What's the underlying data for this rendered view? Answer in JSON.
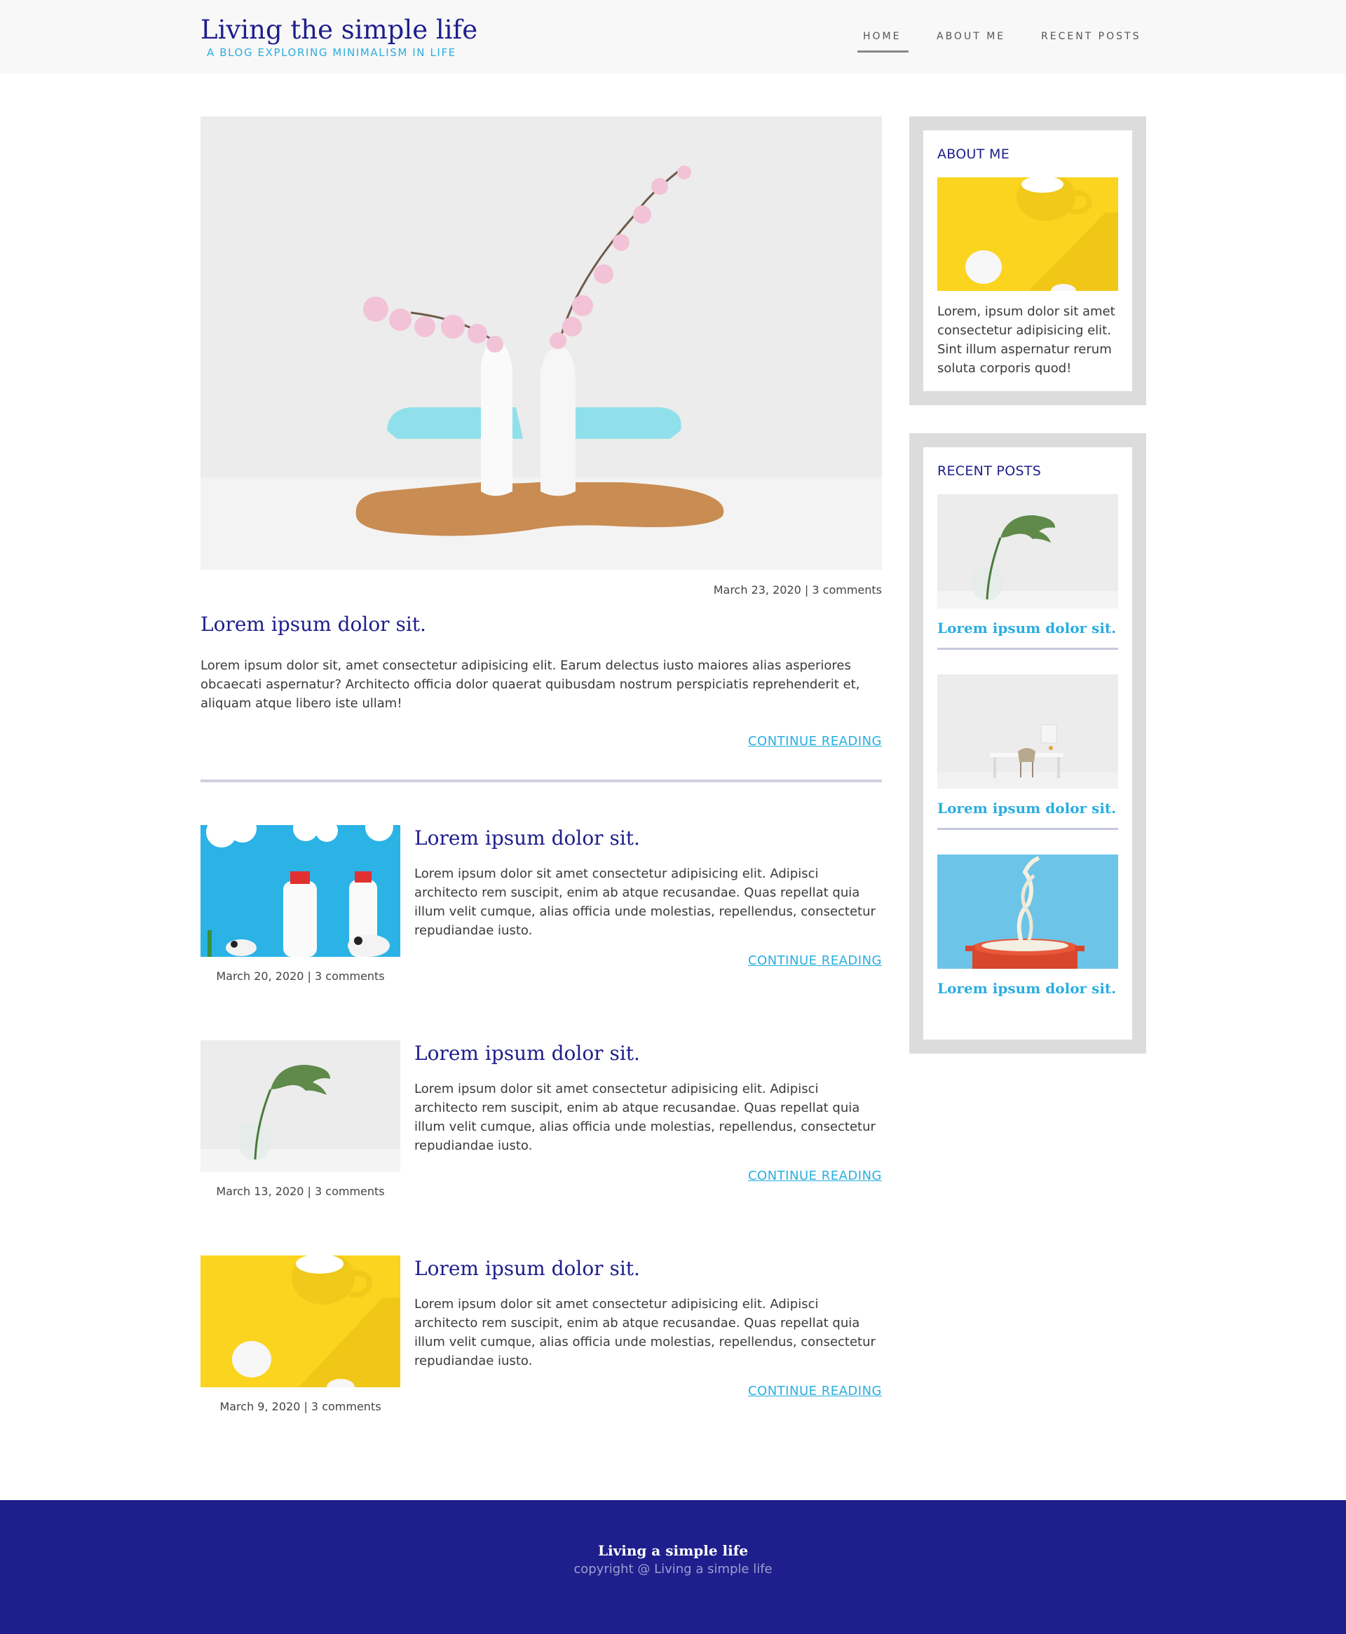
{
  "header": {
    "site_title": "Living the simple life",
    "tagline": "A BLOG EXPLORING MINIMALISM IN LIFE",
    "nav": [
      {
        "label": "HOME",
        "active": true
      },
      {
        "label": "ABOUT ME",
        "active": false
      },
      {
        "label": "RECENT POSTS",
        "active": false
      }
    ]
  },
  "featured": {
    "meta": "March 23, 2020 | 3 comments",
    "title": "Lorem ipsum dolor sit.",
    "excerpt": "Lorem ipsum dolor sit, amet consectetur adipisicing elit. Earum delectus iusto maiores alias asperiores obcaecati aspernatur? Architecto officia dolor quaerat quibusdam nostrum perspiciatis reprehenderit et, aliquam atque libero iste ullam!",
    "continue": "CONTINUE READING"
  },
  "posts": [
    {
      "title": "Lorem ipsum dolor sit.",
      "excerpt": "Lorem ipsum dolor sit amet consectetur adipisicing elit. Adipisci architecto rem suscipit, enim ab atque recusandae. Quas repellat quia illum velit cumque, alias officia unde molestias, repellendus, consectetur repudiandae iusto.",
      "meta": "March 20, 2020 | 3 comments",
      "continue": "CONTINUE READING"
    },
    {
      "title": "Lorem ipsum dolor sit.",
      "excerpt": "Lorem ipsum dolor sit amet consectetur adipisicing elit. Adipisci architecto rem suscipit, enim ab atque recusandae. Quas repellat quia illum velit cumque, alias officia unde molestias, repellendus, consectetur repudiandae iusto.",
      "meta": "March 13, 2020 | 3 comments",
      "continue": "CONTINUE READING"
    },
    {
      "title": "Lorem ipsum dolor sit.",
      "excerpt": "Lorem ipsum dolor sit amet consectetur adipisicing elit. Adipisci architecto rem suscipit, enim ab atque recusandae. Quas repellat quia illum velit cumque, alias officia unde molestias, repellendus, consectetur repudiandae iusto.",
      "meta": "March 9, 2020 | 3 comments",
      "continue": "CONTINUE READING"
    }
  ],
  "sidebar": {
    "about": {
      "heading": "ABOUT ME",
      "text": "Lorem, ipsum dolor sit amet consectetur adipisicing elit. Sint illum aspernatur rerum soluta corporis quod!"
    },
    "recent": {
      "heading": "RECENT POSTS",
      "items": [
        {
          "title": "Lorem ipsum dolor sit."
        },
        {
          "title": "Lorem ipsum dolor sit."
        },
        {
          "title": "Lorem ipsum dolor sit."
        }
      ]
    }
  },
  "footer": {
    "title": "Living a simple life",
    "copyright": "copyright @ Living a simple life"
  },
  "colors": {
    "brand_navy": "#1e1e8c",
    "accent_cyan": "#2aaee0",
    "sidebar_gray": "#dcdcdc"
  }
}
